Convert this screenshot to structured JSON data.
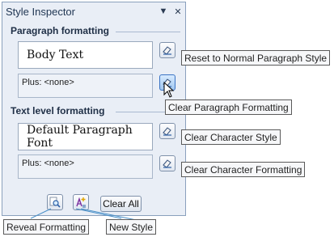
{
  "panel": {
    "title": "Style Inspector",
    "dropdown_glyph": "▼",
    "close_glyph": "✕"
  },
  "paragraph": {
    "heading": "Paragraph formatting",
    "style_name": "Body Text",
    "plus_text": "Plus: <none>"
  },
  "text_level": {
    "heading": "Text level formatting",
    "style_name": "Default Paragraph Font",
    "plus_text": "Plus: <none>"
  },
  "buttons": {
    "clear_all": "Clear All"
  },
  "callouts": {
    "reset_paragraph": "Reset to Normal Paragraph Style",
    "clear_paragraph_formatting": "Clear Paragraph Formatting",
    "clear_character_style": "Clear Character Style",
    "clear_character_formatting": "Clear Character Formatting",
    "reveal_formatting": "Reveal Formatting",
    "new_style": "New Style"
  },
  "icons": {
    "eraser": "eraser-icon",
    "reveal": "magnifier-icon",
    "new_style": "new-style-icon"
  },
  "colors": {
    "panel_bg": "#e9eef6",
    "border": "#8aa0bd",
    "active_button": "#9fc6f0"
  }
}
